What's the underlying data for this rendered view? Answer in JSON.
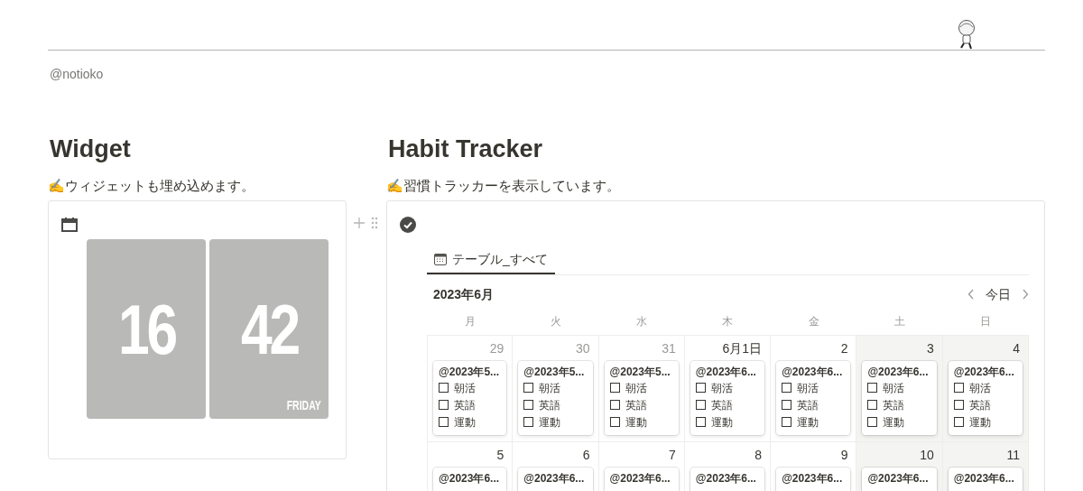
{
  "header": {
    "handle": "@notioko"
  },
  "widget_section": {
    "title": "Widget",
    "description": "✍ウィジェットも埋め込めます。",
    "clock": {
      "hours": "16",
      "minutes": "42",
      "weekday": "FRIDAY"
    }
  },
  "tracker_section": {
    "title": "Habit Tracker",
    "description": "✍習慣トラッカーを表示しています。",
    "tabs": [
      {
        "label": "テーブル_すべて",
        "selected": true
      }
    ],
    "month": "2023年6月",
    "today_button": "今日",
    "weekdays": [
      "月",
      "火",
      "水",
      "木",
      "金",
      "土",
      "日"
    ],
    "weeks": [
      {
        "days": [
          {
            "label": "29",
            "other_month": true,
            "weekend": false,
            "entry": {
              "title": "@2023年5...",
              "habits": [
                {
                  "label": "朝活",
                  "checked": false
                },
                {
                  "label": "英語",
                  "checked": false
                },
                {
                  "label": "運動",
                  "checked": false
                }
              ]
            }
          },
          {
            "label": "30",
            "other_month": true,
            "weekend": false,
            "entry": {
              "title": "@2023年5...",
              "habits": [
                {
                  "label": "朝活",
                  "checked": false
                },
                {
                  "label": "英語",
                  "checked": false
                },
                {
                  "label": "運動",
                  "checked": false
                }
              ]
            }
          },
          {
            "label": "31",
            "other_month": true,
            "weekend": false,
            "entry": {
              "title": "@2023年5...",
              "habits": [
                {
                  "label": "朝活",
                  "checked": false
                },
                {
                  "label": "英語",
                  "checked": false
                },
                {
                  "label": "運動",
                  "checked": false
                }
              ]
            }
          },
          {
            "label": "6月1日",
            "other_month": false,
            "weekend": false,
            "entry": {
              "title": "@2023年6...",
              "habits": [
                {
                  "label": "朝活",
                  "checked": false
                },
                {
                  "label": "英語",
                  "checked": false
                },
                {
                  "label": "運動",
                  "checked": false
                }
              ]
            }
          },
          {
            "label": "2",
            "other_month": false,
            "weekend": false,
            "entry": {
              "title": "@2023年6...",
              "habits": [
                {
                  "label": "朝活",
                  "checked": false
                },
                {
                  "label": "英語",
                  "checked": false
                },
                {
                  "label": "運動",
                  "checked": false
                }
              ]
            }
          },
          {
            "label": "3",
            "other_month": false,
            "weekend": true,
            "entry": {
              "title": "@2023年6...",
              "habits": [
                {
                  "label": "朝活",
                  "checked": false
                },
                {
                  "label": "英語",
                  "checked": false
                },
                {
                  "label": "運動",
                  "checked": false
                }
              ]
            }
          },
          {
            "label": "4",
            "other_month": false,
            "weekend": true,
            "entry": {
              "title": "@2023年6...",
              "habits": [
                {
                  "label": "朝活",
                  "checked": false
                },
                {
                  "label": "英語",
                  "checked": false
                },
                {
                  "label": "運動",
                  "checked": false
                }
              ]
            }
          }
        ]
      },
      {
        "days": [
          {
            "label": "5",
            "other_month": false,
            "weekend": false,
            "entry": {
              "title": "@2023年6..."
            }
          },
          {
            "label": "6",
            "other_month": false,
            "weekend": false,
            "entry": {
              "title": "@2023年6..."
            }
          },
          {
            "label": "7",
            "other_month": false,
            "weekend": false,
            "entry": {
              "title": "@2023年6..."
            }
          },
          {
            "label": "8",
            "other_month": false,
            "weekend": false,
            "entry": {
              "title": "@2023年6..."
            }
          },
          {
            "label": "9",
            "other_month": false,
            "weekend": false,
            "entry": {
              "title": "@2023年6..."
            }
          },
          {
            "label": "10",
            "other_month": false,
            "weekend": true,
            "entry": {
              "title": "@2023年6..."
            }
          },
          {
            "label": "11",
            "other_month": false,
            "weekend": true,
            "entry": {
              "title": "@2023年6..."
            }
          }
        ]
      }
    ]
  }
}
